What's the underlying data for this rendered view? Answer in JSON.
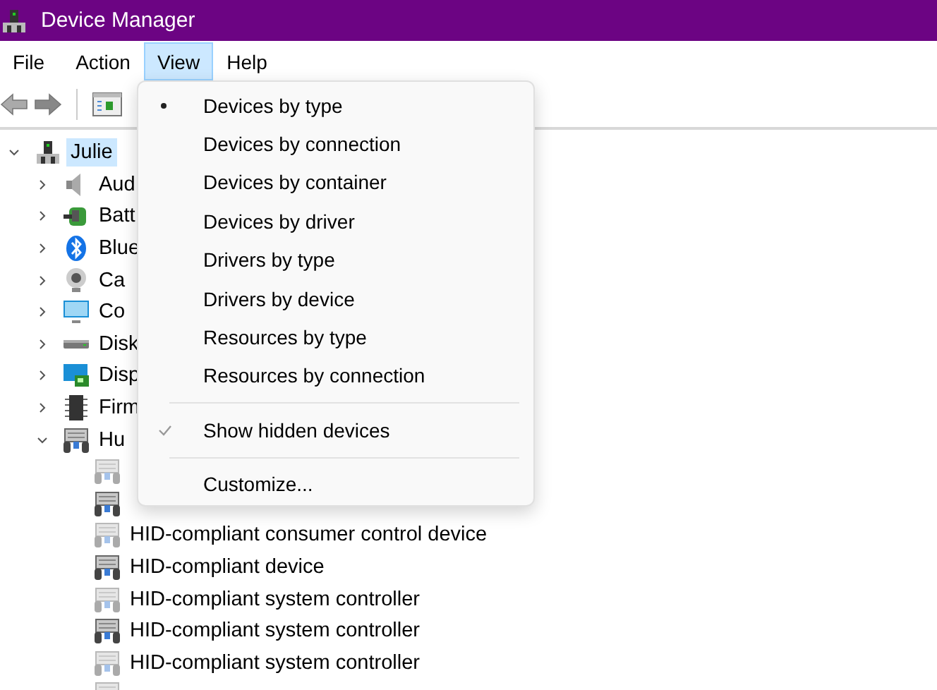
{
  "window": {
    "title": "Device Manager"
  },
  "menubar": [
    {
      "label": "File",
      "selected": false
    },
    {
      "label": "Action",
      "selected": false
    },
    {
      "label": "View",
      "selected": true
    },
    {
      "label": "Help",
      "selected": false
    }
  ],
  "tree": {
    "label": "Julie",
    "expanded": true,
    "selected": true,
    "children": [
      {
        "label": "Aud",
        "kind": "speaker",
        "expanded": false
      },
      {
        "label": "Batt",
        "kind": "battery",
        "expanded": false
      },
      {
        "label": "Blue",
        "kind": "bluetooth",
        "expanded": false
      },
      {
        "label": "Ca",
        "kind": "camera",
        "expanded": false
      },
      {
        "label": "Co",
        "kind": "monitor",
        "expanded": false
      },
      {
        "label": "Disk",
        "kind": "disk",
        "expanded": false
      },
      {
        "label": "Disp",
        "kind": "display",
        "expanded": false
      },
      {
        "label": "Firm",
        "kind": "chip",
        "expanded": false
      },
      {
        "label": "Hu",
        "kind": "hid",
        "expanded": true,
        "children": [
          {
            "hidden": true
          },
          {
            "hidden": false
          },
          {
            "label": "HID-compliant consumer control device",
            "hidden": true
          },
          {
            "label": "HID-compliant device",
            "hidden": false
          },
          {
            "label": "HID-compliant system controller",
            "hidden": true
          },
          {
            "label": "HID-compliant system controller",
            "hidden": false
          },
          {
            "label": "HID-compliant system controller",
            "hidden": true
          },
          {
            "hidden": true
          }
        ]
      }
    ]
  },
  "view_menu": [
    {
      "kind": "radio",
      "label": "Devices by type",
      "selected": true
    },
    {
      "kind": "radio",
      "label": "Devices by connection",
      "selected": false
    },
    {
      "kind": "radio",
      "label": "Devices by container",
      "selected": false
    },
    {
      "kind": "radio",
      "label": "Devices by driver",
      "selected": false
    },
    {
      "kind": "radio",
      "label": "Drivers by type",
      "selected": false
    },
    {
      "kind": "radio",
      "label": "Drivers by device",
      "selected": false
    },
    {
      "kind": "radio",
      "label": "Resources by type",
      "selected": false
    },
    {
      "kind": "radio",
      "label": "Resources by connection",
      "selected": false
    },
    {
      "kind": "separator"
    },
    {
      "kind": "check",
      "label": "Show hidden devices",
      "checked": true
    },
    {
      "kind": "separator"
    },
    {
      "kind": "command",
      "label": "Customize..."
    }
  ]
}
